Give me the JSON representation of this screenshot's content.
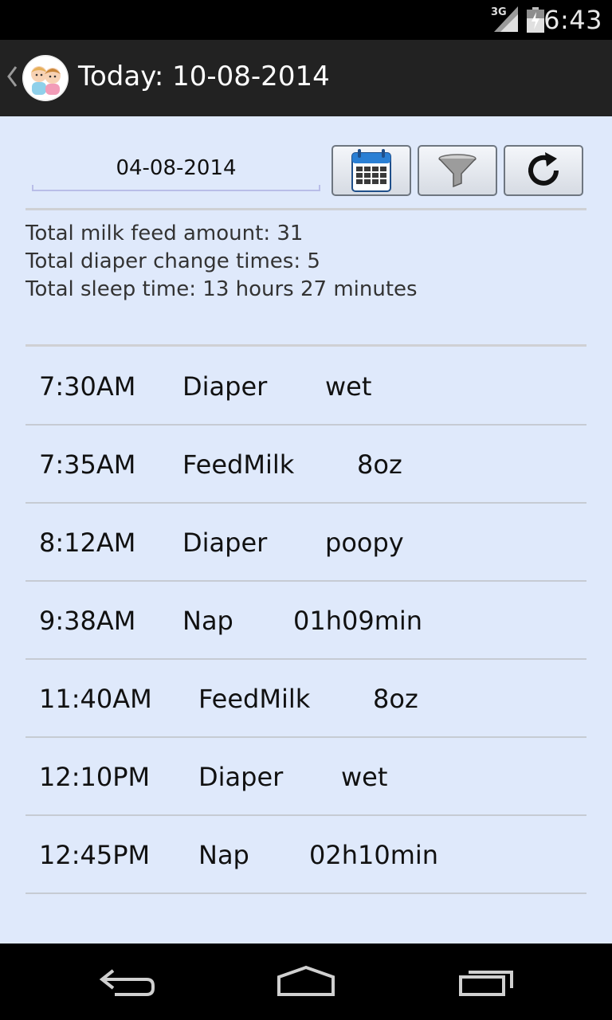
{
  "status_bar": {
    "network": "3G",
    "time": "6:43",
    "icons": [
      "signal-icon",
      "battery-icon"
    ]
  },
  "action_bar": {
    "title": "Today: 10-08-2014",
    "icons": [
      "back-chevron-icon",
      "app-logo-icon"
    ]
  },
  "filter": {
    "date_value": "04-08-2014",
    "buttons": [
      "calendar-icon",
      "filter-funnel-icon",
      "refresh-icon"
    ]
  },
  "summary": {
    "milk": "Total milk feed amount: 31",
    "diaper": "Total diaper change times: 5",
    "sleep": "Total sleep time: 13 hours 27 minutes"
  },
  "events": [
    {
      "time": "7:30AM",
      "type": "Diaper",
      "detail": "wet"
    },
    {
      "time": "7:35AM",
      "type": "FeedMilk",
      "detail": "8oz"
    },
    {
      "time": "8:12AM",
      "type": "Diaper",
      "detail": "poopy"
    },
    {
      "time": "9:38AM",
      "type": "Nap",
      "detail": "01h09min"
    },
    {
      "time": "11:40AM",
      "type": "FeedMilk",
      "detail": "8oz"
    },
    {
      "time": "12:10PM",
      "type": "Diaper",
      "detail": "wet"
    },
    {
      "time": "12:45PM",
      "type": "Nap",
      "detail": "02h10min"
    }
  ],
  "nav_bar": {
    "icons": [
      "back-icon",
      "home-icon",
      "recent-apps-icon"
    ]
  },
  "colors": {
    "content_background": "#dfe9fb",
    "action_bar": "#222222",
    "calendar_accent": "#2a7fd4"
  }
}
